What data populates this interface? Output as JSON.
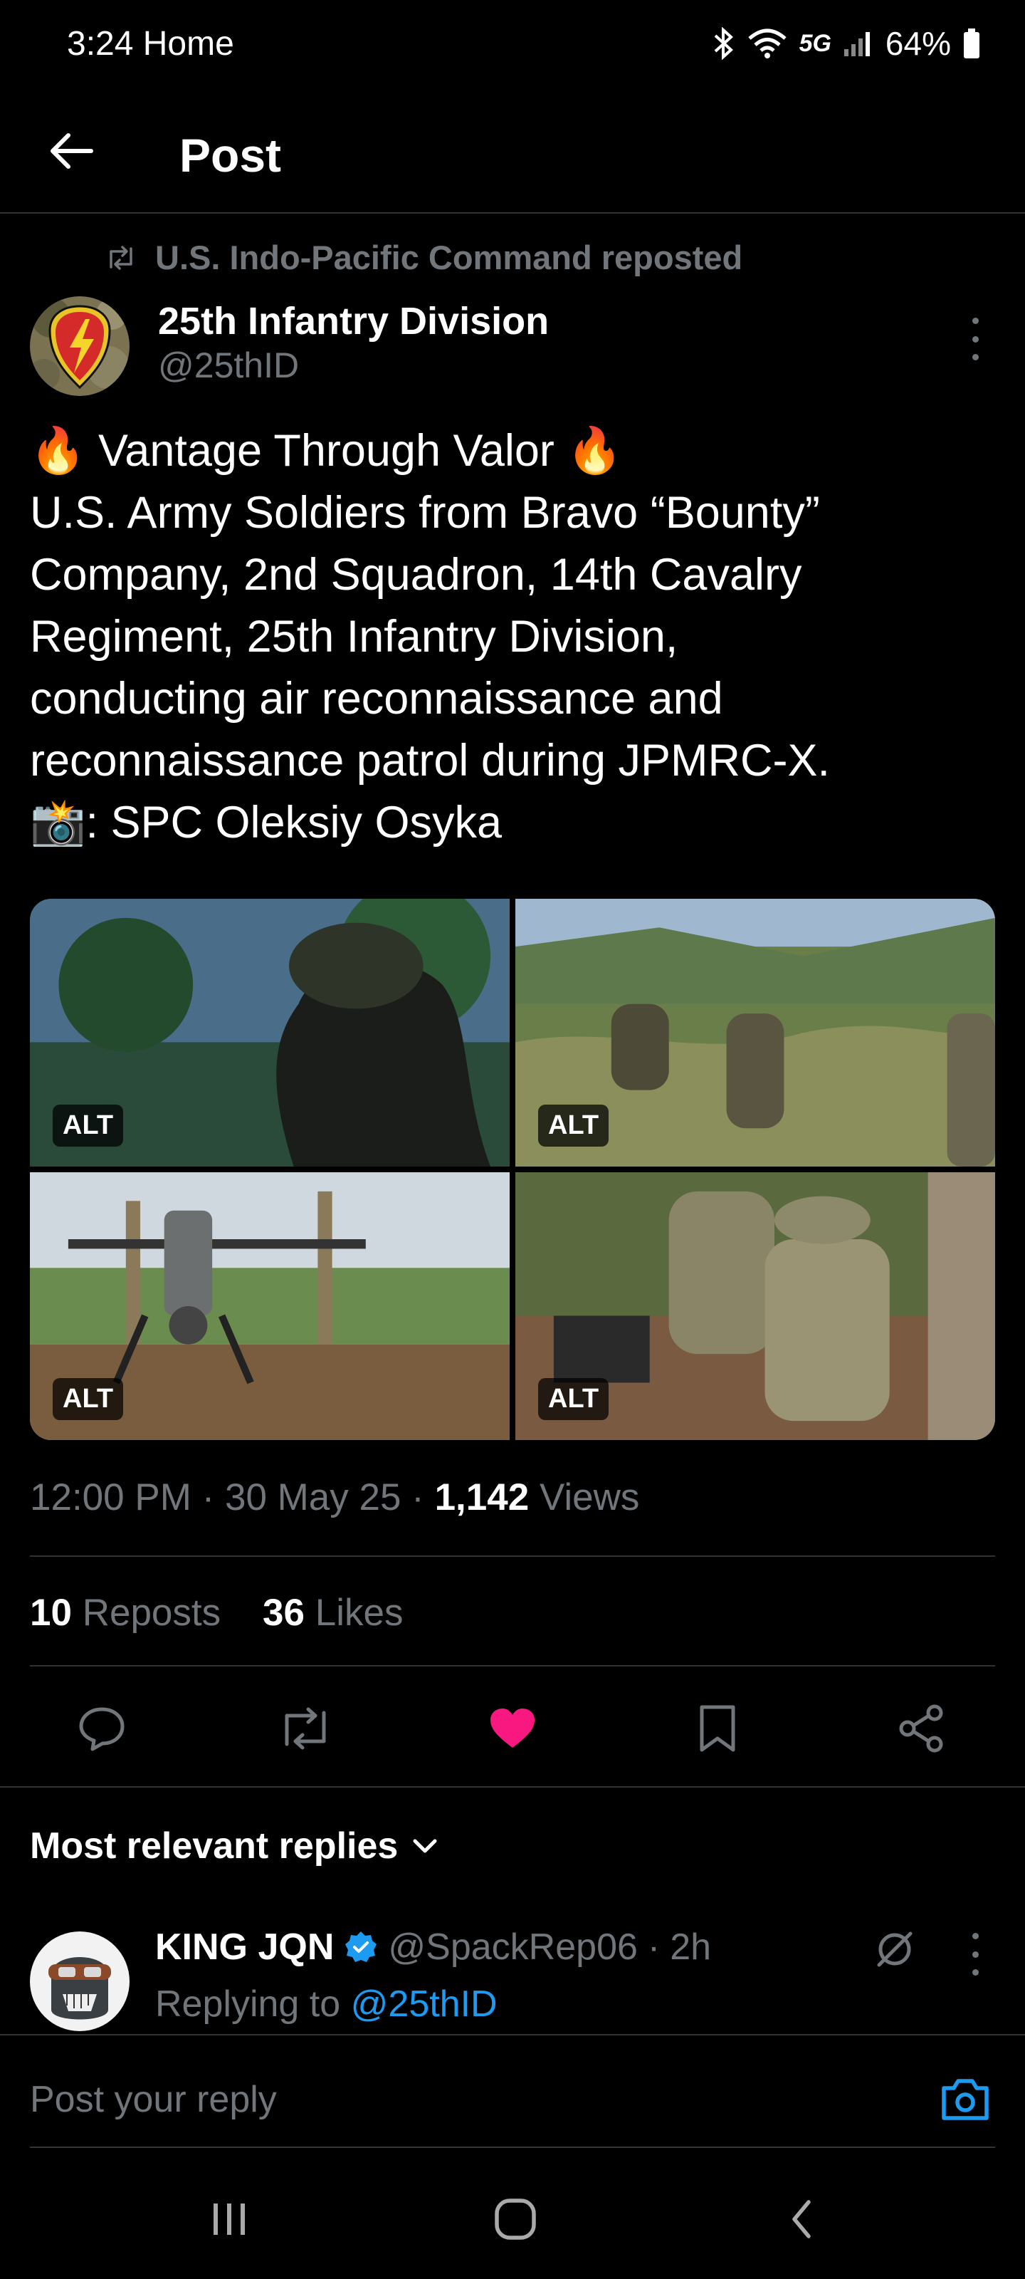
{
  "status_bar": {
    "time": "3:24",
    "carrier": "Home",
    "network": "5G",
    "battery": "64%",
    "icons": [
      "bluetooth-icon",
      "wifi-icon",
      "signal-icon",
      "battery-icon"
    ]
  },
  "header": {
    "title": "Post"
  },
  "post": {
    "repost_label": "U.S. Indo-Pacific Command reposted",
    "author_name": "25th Infantry Division",
    "author_handle": "@25thID",
    "text_lines": [
      "🔥 Vantage Through Valor 🔥",
      "U.S. Army Soldiers from Bravo “Bounty”",
      "Company, 2nd Squadron, 14th Cavalry",
      "Regiment, 25th Infantry Division,",
      "conducting air reconnaissance and",
      "reconnaissance patrol during JPMRC-X.",
      "📸: SPC Oleksiy Osyka"
    ],
    "media_alt_label": "ALT",
    "time": "12:00 PM",
    "date": "30 May 25",
    "views_count": "1,142",
    "views_label": "Views",
    "reposts_count": "10",
    "reposts_label": "Reposts",
    "likes_count": "36",
    "likes_label": "Likes",
    "liked": true
  },
  "replies": {
    "sort_label": "Most relevant replies",
    "items": [
      {
        "name": "KING JQN",
        "verified": true,
        "handle": "@SpackRep06",
        "time": "2h",
        "replying_prefix": "Replying to",
        "replying_to": "@25thID"
      }
    ]
  },
  "composer": {
    "placeholder": "Post your reply"
  },
  "colors": {
    "accent": "#1d9bf0",
    "like": "#f91880",
    "background": "#000000",
    "muted": "#71767b"
  }
}
